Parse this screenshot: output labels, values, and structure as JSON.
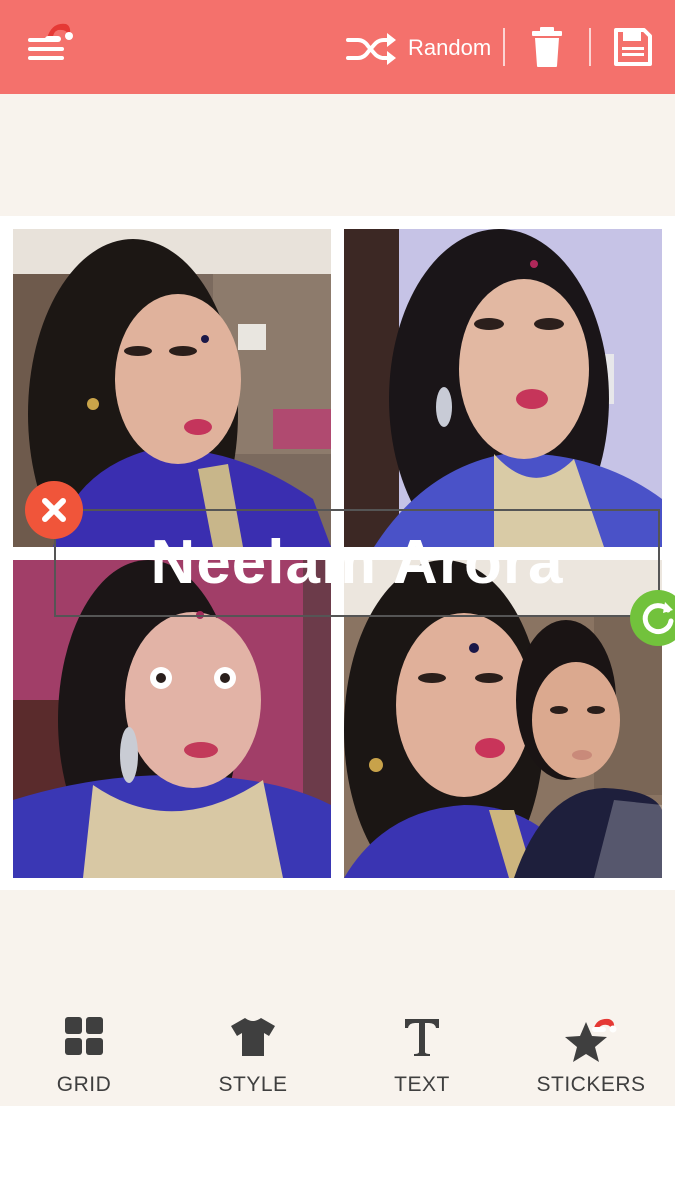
{
  "topbar": {
    "random_label": "Random",
    "bg_color": "#f4716c",
    "icons": [
      "menu-icon",
      "santa-hat-icon",
      "shuffle-icon",
      "trash-icon",
      "save-icon"
    ]
  },
  "collage": {
    "photos": [
      {
        "name": "photo-top-left"
      },
      {
        "name": "photo-top-right"
      },
      {
        "name": "photo-bottom-left"
      },
      {
        "name": "photo-bottom-right"
      }
    ]
  },
  "text_sticker": {
    "text": "Neelam Arora",
    "text_color": "#ffffff"
  },
  "handles": {
    "close_color": "#f0553a",
    "rotate_color": "#72c23c"
  },
  "toolbar": {
    "items": [
      {
        "label": "GRID",
        "icon": "grid-icon"
      },
      {
        "label": "STYLE",
        "icon": "shirt-icon"
      },
      {
        "label": "TEXT",
        "icon": "text-icon"
      },
      {
        "label": "STICKERS",
        "icon": "star-icon"
      }
    ]
  }
}
